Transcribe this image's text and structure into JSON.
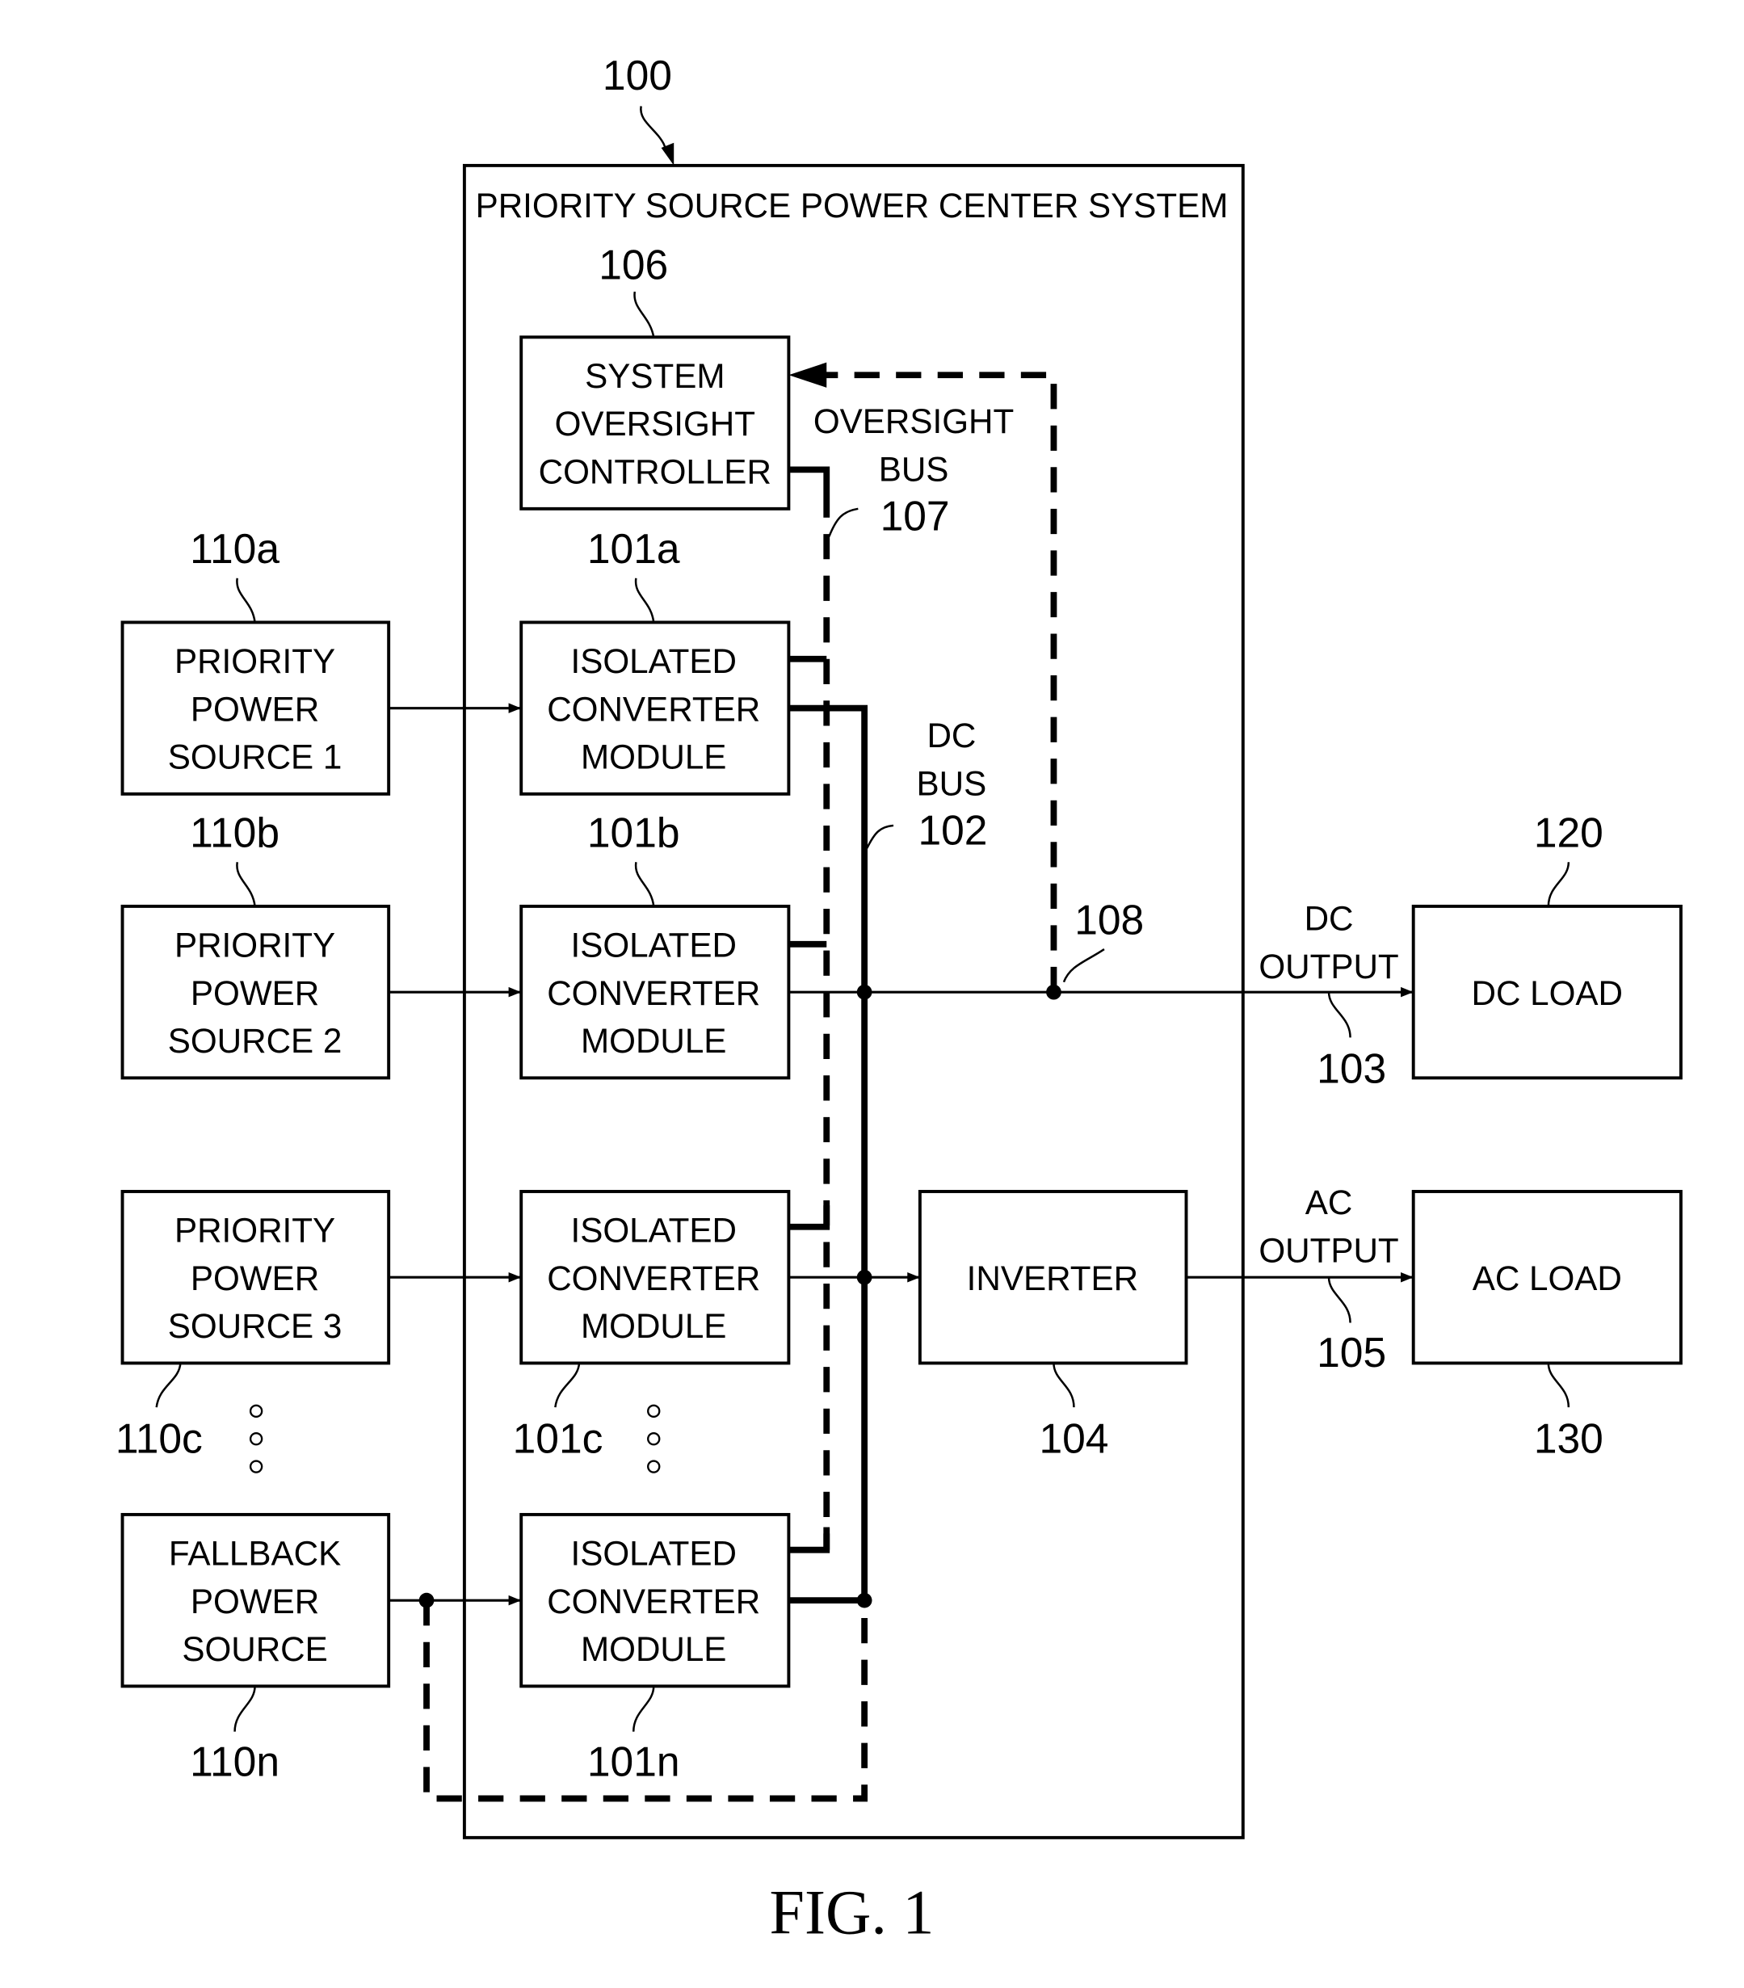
{
  "figure": {
    "caption": "FIG. 1",
    "system": {
      "ref": "100",
      "title": "PRIORITY SOURCE POWER CENTER SYSTEM"
    },
    "controller": {
      "ref": "106",
      "lines": [
        "SYSTEM",
        "OVERSIGHT",
        "CONTROLLER"
      ]
    },
    "oversight_bus": {
      "ref": "107",
      "lines": [
        "OVERSIGHT",
        "BUS"
      ]
    },
    "dc_bus": {
      "ref": "102",
      "lines": [
        "DC",
        "BUS"
      ]
    },
    "junction": {
      "ref": "108"
    },
    "sources": [
      {
        "ref": "110a",
        "lines": [
          "PRIORITY",
          "POWER",
          "SOURCE 1"
        ]
      },
      {
        "ref": "110b",
        "lines": [
          "PRIORITY",
          "POWER",
          "SOURCE 2"
        ]
      },
      {
        "ref": "110c",
        "lines": [
          "PRIORITY",
          "POWER",
          "SOURCE 3"
        ]
      },
      {
        "ref": "110n",
        "lines": [
          "FALLBACK",
          "POWER",
          "SOURCE"
        ]
      }
    ],
    "converters": [
      {
        "ref": "101a",
        "lines": [
          "ISOLATED",
          "CONVERTER",
          "MODULE"
        ]
      },
      {
        "ref": "101b",
        "lines": [
          "ISOLATED",
          "CONVERTER",
          "MODULE"
        ]
      },
      {
        "ref": "101c",
        "lines": [
          "ISOLATED",
          "CONVERTER",
          "MODULE"
        ]
      },
      {
        "ref": "101n",
        "lines": [
          "ISOLATED",
          "CONVERTER",
          "MODULE"
        ]
      }
    ],
    "inverter": {
      "ref": "104",
      "label": "INVERTER"
    },
    "dc_output": {
      "ref": "103",
      "lines": [
        "DC",
        "OUTPUT"
      ]
    },
    "ac_output": {
      "ref": "105",
      "lines": [
        "AC",
        "OUTPUT"
      ]
    },
    "dc_load": {
      "ref": "120",
      "label": "DC LOAD"
    },
    "ac_load": {
      "ref": "130",
      "label": "AC LOAD"
    }
  }
}
